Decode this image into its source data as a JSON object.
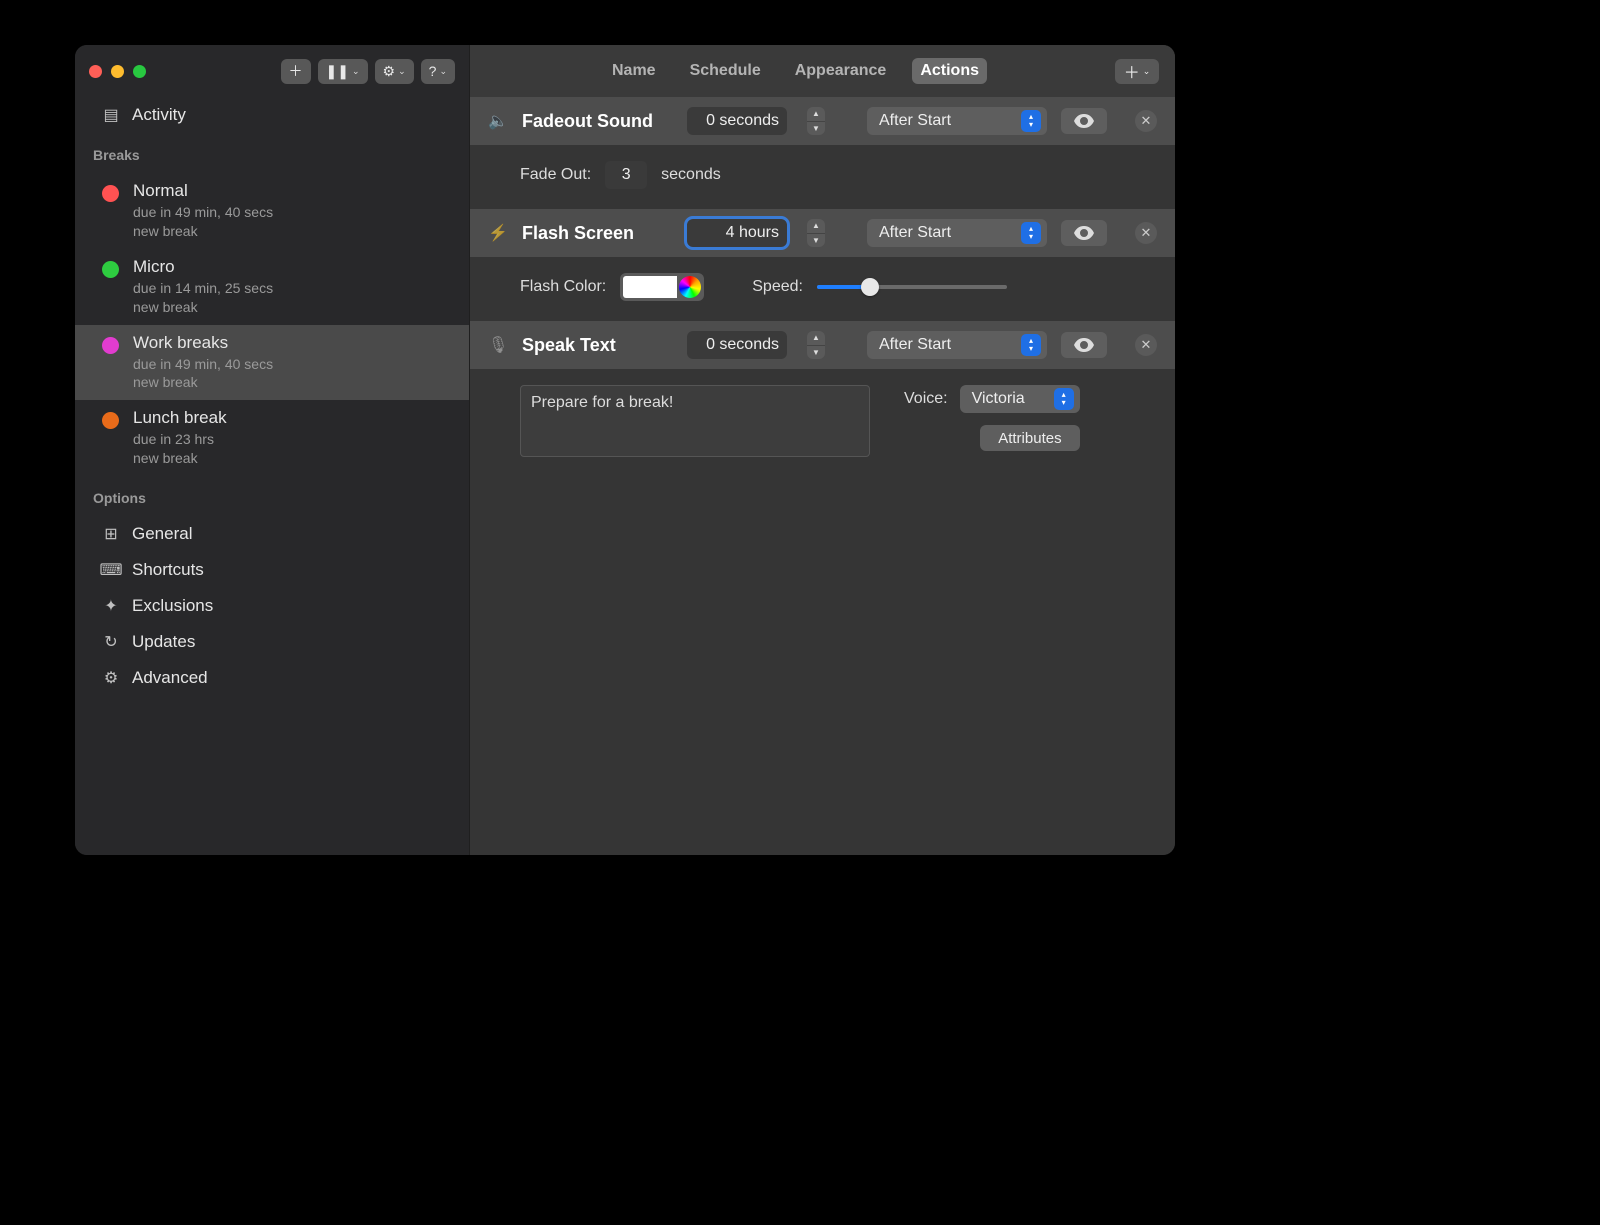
{
  "sidebar": {
    "activity_label": "Activity",
    "breaks_header": "Breaks",
    "breaks": [
      {
        "color": "#ff5252",
        "title": "Normal",
        "due": "due in 49 min, 40 secs",
        "sub": "new break",
        "selected": false
      },
      {
        "color": "#2ecc40",
        "title": "Micro",
        "due": "due in 14 min, 25 secs",
        "sub": "new break",
        "selected": false
      },
      {
        "color": "#e23ccf",
        "title": "Work breaks",
        "due": "due in 49 min, 40 secs",
        "sub": "new break",
        "selected": true
      },
      {
        "color": "#e86b1a",
        "title": "Lunch break",
        "due": "due in 23 hrs",
        "sub": "new break",
        "selected": false
      }
    ],
    "options_header": "Options",
    "options": [
      {
        "icon": "⊞",
        "label": "General"
      },
      {
        "icon": "⌘",
        "label": "Shortcuts"
      },
      {
        "icon": "✦",
        "label": "Exclusions"
      },
      {
        "icon": "↻",
        "label": "Updates"
      },
      {
        "icon": "⚙",
        "label": "Advanced"
      }
    ]
  },
  "tabs": {
    "items": [
      "Name",
      "Schedule",
      "Appearance",
      "Actions"
    ],
    "active": "Actions"
  },
  "actions": {
    "fadeout": {
      "title": "Fadeout Sound",
      "value": "0 seconds",
      "when": "After Start",
      "fade_label": "Fade Out:",
      "fade_value": "3",
      "fade_unit": "seconds"
    },
    "flash": {
      "title": "Flash Screen",
      "value": "4 hours",
      "when": "After Start",
      "color_label": "Flash Color:",
      "color": "#ffffff",
      "speed_label": "Speed:",
      "speed_pct": 28
    },
    "speak": {
      "title": "Speak Text",
      "value": "0 seconds",
      "when": "After Start",
      "text": "Prepare for a break!",
      "voice_label": "Voice:",
      "voice": "Victoria",
      "attributes_label": "Attributes"
    }
  }
}
